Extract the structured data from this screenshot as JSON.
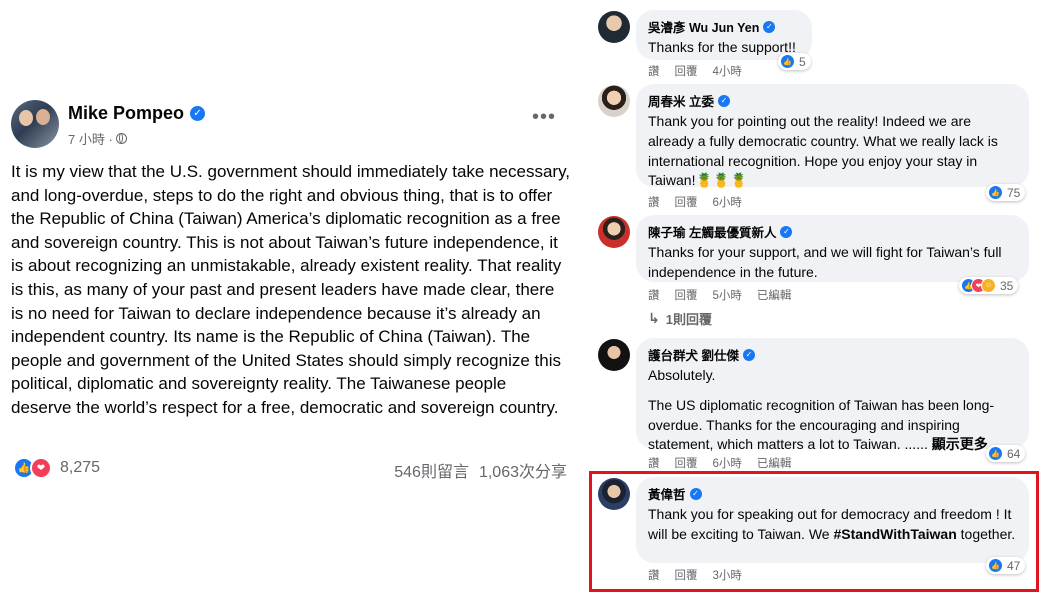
{
  "post": {
    "author": "Mike Pompeo",
    "time": "7 小時 ·",
    "more_label": "•••",
    "text": "It is my view that the U.S. government should immediately take necessary, and long-overdue, steps to do the right and obvious thing, that is to offer the Republic of China (Taiwan) America’s diplomatic recognition as a free and sovereign country. This is not about Taiwan’s future independence, it is about recognizing an unmistakable, already existent reality. That reality is this, as many of your past and present leaders have made clear, there is no need for Taiwan to declare independence because it’s already an independent country. Its name is the Republic of China (Taiwan). The people and government of the United States should simply recognize this political, diplomatic and sovereignty reality. The Taiwanese people deserve the world’s respect for a free, democratic and sovereign country.",
    "reaction_count": "8,275",
    "comments_count": "546則留言",
    "shares_count": "1,063次分享",
    "reaction_icons": [
      "like-icon",
      "love-icon"
    ]
  },
  "comments": [
    {
      "name": "吳濬彥 Wu Jun Yen",
      "text": "Thanks for the support!!",
      "actions": [
        "讚",
        "回覆",
        "4小時"
      ],
      "reactions": "5",
      "reaction_icons": [
        "like-icon"
      ]
    },
    {
      "name": "周春米 立委",
      "text": "Thank you for pointing out the reality! Indeed we are already a fully democratic country. What we really lack is international recognition. Hope you enjoy your stay in Taiwan!🍍🍍🍍",
      "actions": [
        "讚",
        "回覆",
        "6小時"
      ],
      "reactions": "75",
      "reaction_icons": [
        "like-icon"
      ]
    },
    {
      "name": "陳子瑜 左觸最優質新人",
      "text": "Thanks for your support, and we will fight for Taiwan’s full independence in the future.",
      "actions": [
        "讚",
        "回覆",
        "5小時",
        "已編輯"
      ],
      "reactions": "35",
      "reaction_icons": [
        "like-icon",
        "love-icon",
        "haha-icon"
      ],
      "replies": "1則回覆"
    },
    {
      "name": "護台群犬 劉仕傑",
      "text_1": "Absolutely.",
      "text_2": "The US diplomatic recognition of Taiwan has been long-overdue. Thanks for the encouraging and inspiring statement, which matters a lot to Taiwan. ......",
      "see_more": "顯示更多",
      "actions": [
        "讚",
        "回覆",
        "6小時",
        "已編輯"
      ],
      "reactions": "64",
      "reaction_icons": [
        "like-icon"
      ]
    },
    {
      "name": "黃偉哲",
      "text_before": "Thank you for speaking out for democracy and freedom ! It will be exciting to Taiwan. We ",
      "hashtag": "#StandWithTaiwan",
      "text_after": " together.",
      "actions": [
        "讚",
        "回覆",
        "3小時"
      ],
      "reactions": "47",
      "reaction_icons": [
        "like-icon"
      ]
    }
  ],
  "colors": {
    "accent": "#1877f2",
    "bubble": "#f0f2f5",
    "highlight": "#e0141e",
    "secondary_text": "#65676b"
  }
}
